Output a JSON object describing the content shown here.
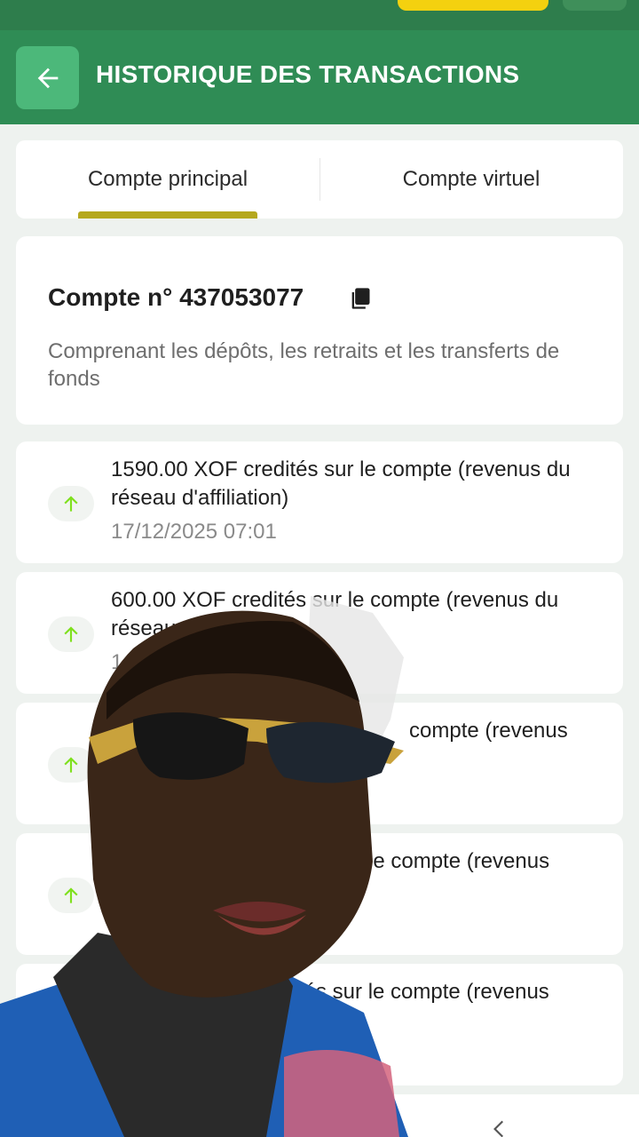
{
  "header": {
    "title": "HISTORIQUE DES TRANSACTIONS",
    "back_icon": "arrow-left-icon"
  },
  "tabs": [
    {
      "label": "Compte principal",
      "active": true
    },
    {
      "label": "Compte virtuel",
      "active": false
    }
  ],
  "account": {
    "title": "Compte n° 437053077",
    "description": "Comprenant les dépôts, les retraits et les transferts de fonds",
    "copy_icon": "copy-icon"
  },
  "transactions": [
    {
      "text": "1590.00 XOF credités sur le compte (revenus du réseau d'affiliation)",
      "date": "17/12/2025 07:01"
    },
    {
      "text": "600.00 XOF credités sur le compte (revenus du réseau d'affiliation)",
      "date": "1"
    },
    {
      "text": "compte (revenus",
      "date": ""
    },
    {
      "text": "le compte (revenus",
      "date": ""
    },
    {
      "text": "tés sur le compte (revenus ation)",
      "date": ""
    }
  ],
  "colors": {
    "header": "#2f8c55",
    "accent_underline": "#b5a81e",
    "arrow_up": "#7fe01e"
  },
  "bottom_nav": {
    "back_icon": "chevron-left-icon"
  }
}
